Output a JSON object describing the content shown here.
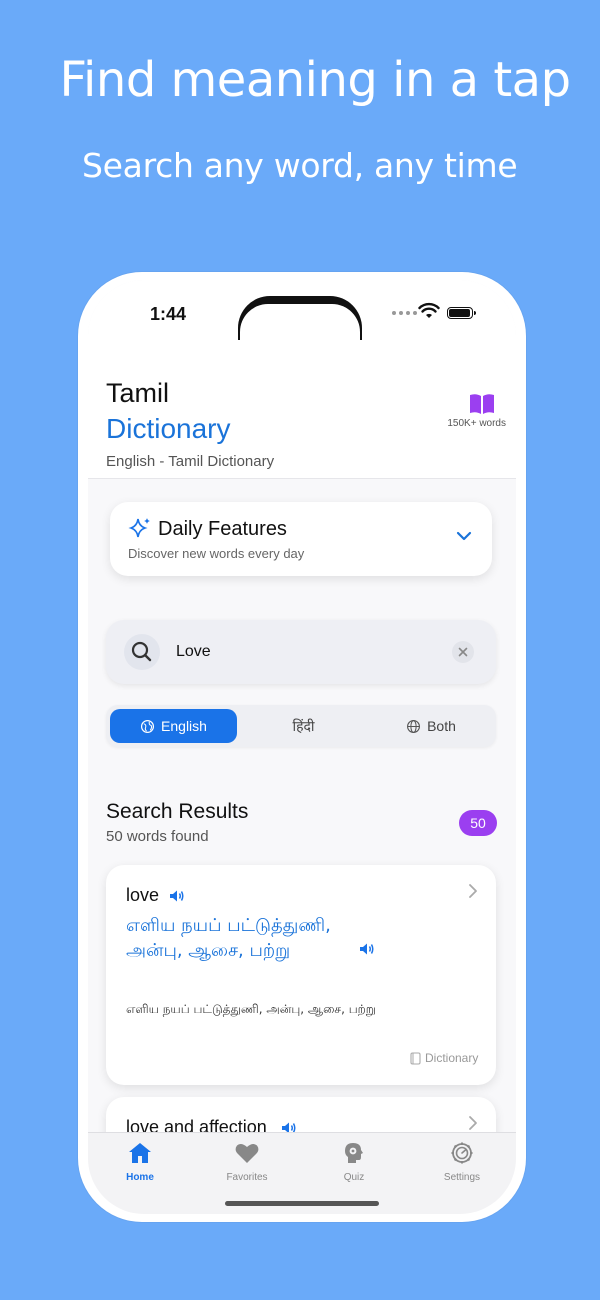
{
  "promo": {
    "title": "Find meaning in a tap",
    "subtitle": "Search any word, any time"
  },
  "status_bar": {
    "time": "1:44"
  },
  "header": {
    "title_line1": "Tamil",
    "title_line2": "Dictionary",
    "subtitle": "English - Tamil Dictionary",
    "word_count": "150K+ words"
  },
  "daily": {
    "title": "Daily Features",
    "subtitle": "Discover new words every day"
  },
  "search": {
    "value": "Love",
    "placeholder": ""
  },
  "language_segments": {
    "english": "English",
    "hindi": "हिंदी",
    "both": "Both",
    "selected": "English"
  },
  "results": {
    "title": "Search Results",
    "count_text": "50 words found",
    "badge": "50",
    "items": [
      {
        "word": "love",
        "tamil_line1": "எளிய நயப் பட்டுத்துணி,",
        "tamil_line2": "அன்பு, ஆசை, பற்று",
        "tamil_small": "எளிய நயப் பட்டுத்துணி, அன்பு, ஆசை, பற்று",
        "source": "Dictionary"
      },
      {
        "word": "love and affection"
      }
    ]
  },
  "tabs": [
    {
      "label": "Home",
      "icon": "home-icon",
      "active": true
    },
    {
      "label": "Favorites",
      "icon": "heart-icon"
    },
    {
      "label": "Quiz",
      "icon": "brain-icon"
    },
    {
      "label": "Settings",
      "icon": "gear-icon"
    }
  ],
  "colors": {
    "background": "#6aaaf9",
    "accent": "#1a73e8",
    "badge": "#9b3ff0",
    "book_icon": "#9b3ff0"
  }
}
